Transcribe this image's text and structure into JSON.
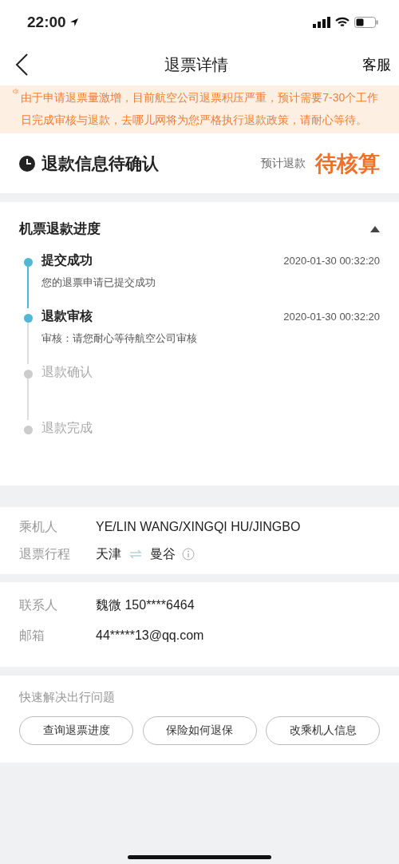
{
  "status_bar": {
    "time": "22:00"
  },
  "nav": {
    "title": "退票详情",
    "action": "客服"
  },
  "notice": {
    "text": "由于申请退票量激增，目前航空公司退票积压严重，预计需要7-30个工作日完成审核与退款，去哪儿网将为您严格执行退款政策，请耐心等待。"
  },
  "refund_status": {
    "title": "退款信息待确认",
    "label": "预计退款",
    "value": "待核算"
  },
  "progress": {
    "title": "机票退款进度",
    "expanded": true,
    "steps": [
      {
        "title": "提交成功",
        "time": "2020-01-30 00:32:20",
        "description": "您的退票申请已提交成功",
        "done": true
      },
      {
        "title": "退款审核",
        "time": "2020-01-30 00:32:20",
        "description": "审核：请您耐心等待航空公司审核",
        "done": true
      },
      {
        "title": "退款确认",
        "done": false
      },
      {
        "title": "退款完成",
        "done": false
      }
    ]
  },
  "passenger": {
    "rows": [
      {
        "label": "乘机人",
        "value": "YE/LIN WANG/XINGQI HU/JINGBO"
      }
    ],
    "route": {
      "label": "退票行程",
      "from": "天津",
      "to": "曼谷"
    }
  },
  "contact": {
    "rows": [
      {
        "label": "联系人",
        "value": "魏微 150****6464"
      },
      {
        "label": "邮箱",
        "value": "44*****13@qq.com"
      }
    ]
  },
  "quick": {
    "title": "快速解决出行问题",
    "buttons": [
      "查询退票进度",
      "保险如何退保",
      "改乘机人信息"
    ]
  }
}
